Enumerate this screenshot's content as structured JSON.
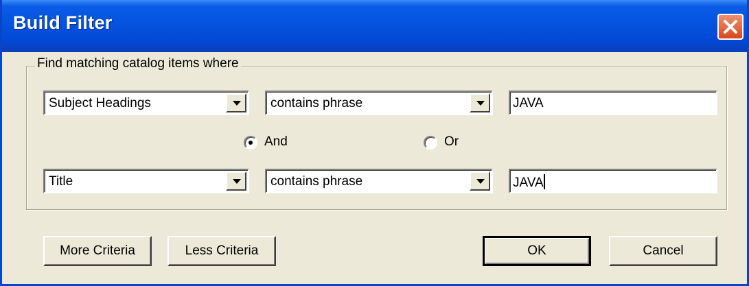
{
  "window": {
    "title": "Build Filter",
    "close_icon": "close-icon"
  },
  "group": {
    "legend": "Find matching catalog items where"
  },
  "criteria": [
    {
      "field": "Subject Headings",
      "operator": "contains phrase",
      "value": "JAVA"
    },
    {
      "field": "Title",
      "operator": "contains phrase",
      "value": "JAVA"
    }
  ],
  "logic": {
    "and_label": "And",
    "or_label": "Or",
    "selected": "And"
  },
  "buttons": {
    "more_criteria": "More Criteria",
    "less_criteria": "Less Criteria",
    "ok": "OK",
    "cancel": "Cancel"
  },
  "colors": {
    "titlebar": "#0552e0",
    "dialog_bg": "#ece9d8",
    "close_button": "#d8471c"
  }
}
